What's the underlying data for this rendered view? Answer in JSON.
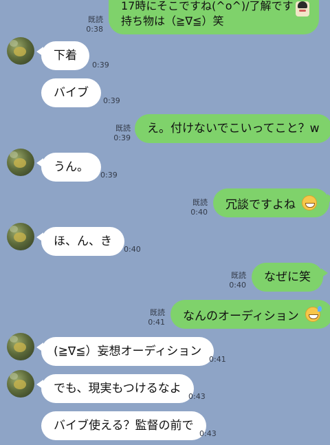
{
  "messages": [
    {
      "id": "m1",
      "side": "out",
      "lines": [
        "17時にそこですね(^o^)/了解です",
        "持ち物は（≧∇≦）笑"
      ],
      "read": "既読",
      "time": "0:38"
    },
    {
      "id": "m2",
      "side": "in",
      "text": "下着",
      "time": "0:39"
    },
    {
      "id": "m3",
      "side": "in",
      "text": "バイブ",
      "time": "0:39"
    },
    {
      "id": "m4",
      "side": "out",
      "text": "え。付けないでこいってこと？w",
      "read": "既読",
      "time": "0:39"
    },
    {
      "id": "m5",
      "side": "in",
      "text": "うん。",
      "time": "0:39"
    },
    {
      "id": "m6",
      "side": "out",
      "text": "冗談ですよね",
      "emoji": "grinning-face-emoji",
      "read": "既読",
      "time": "0:40"
    },
    {
      "id": "m7",
      "side": "in",
      "text": "ほ、ん、き",
      "time": "0:40"
    },
    {
      "id": "m8",
      "side": "out",
      "text": "なぜに笑",
      "read": "既読",
      "time": "0:40"
    },
    {
      "id": "m9",
      "side": "out",
      "text": "なんのオーディション",
      "emoji": "sweat-smile-emoji",
      "read": "既読",
      "time": "0:41"
    },
    {
      "id": "m10",
      "side": "in",
      "text": "(≧∇≦）妄想オーディション",
      "time": "0:41"
    },
    {
      "id": "m11",
      "side": "in",
      "text": "でも、現実もつけるなよ",
      "time": "0:43"
    },
    {
      "id": "m12",
      "side": "in",
      "text": "バイブ使える？監督の前で",
      "time": "0:43"
    }
  ],
  "colors": {
    "background": "#8ea4c6",
    "outgoing": "#7fd26b",
    "incoming": "#ffffff"
  }
}
